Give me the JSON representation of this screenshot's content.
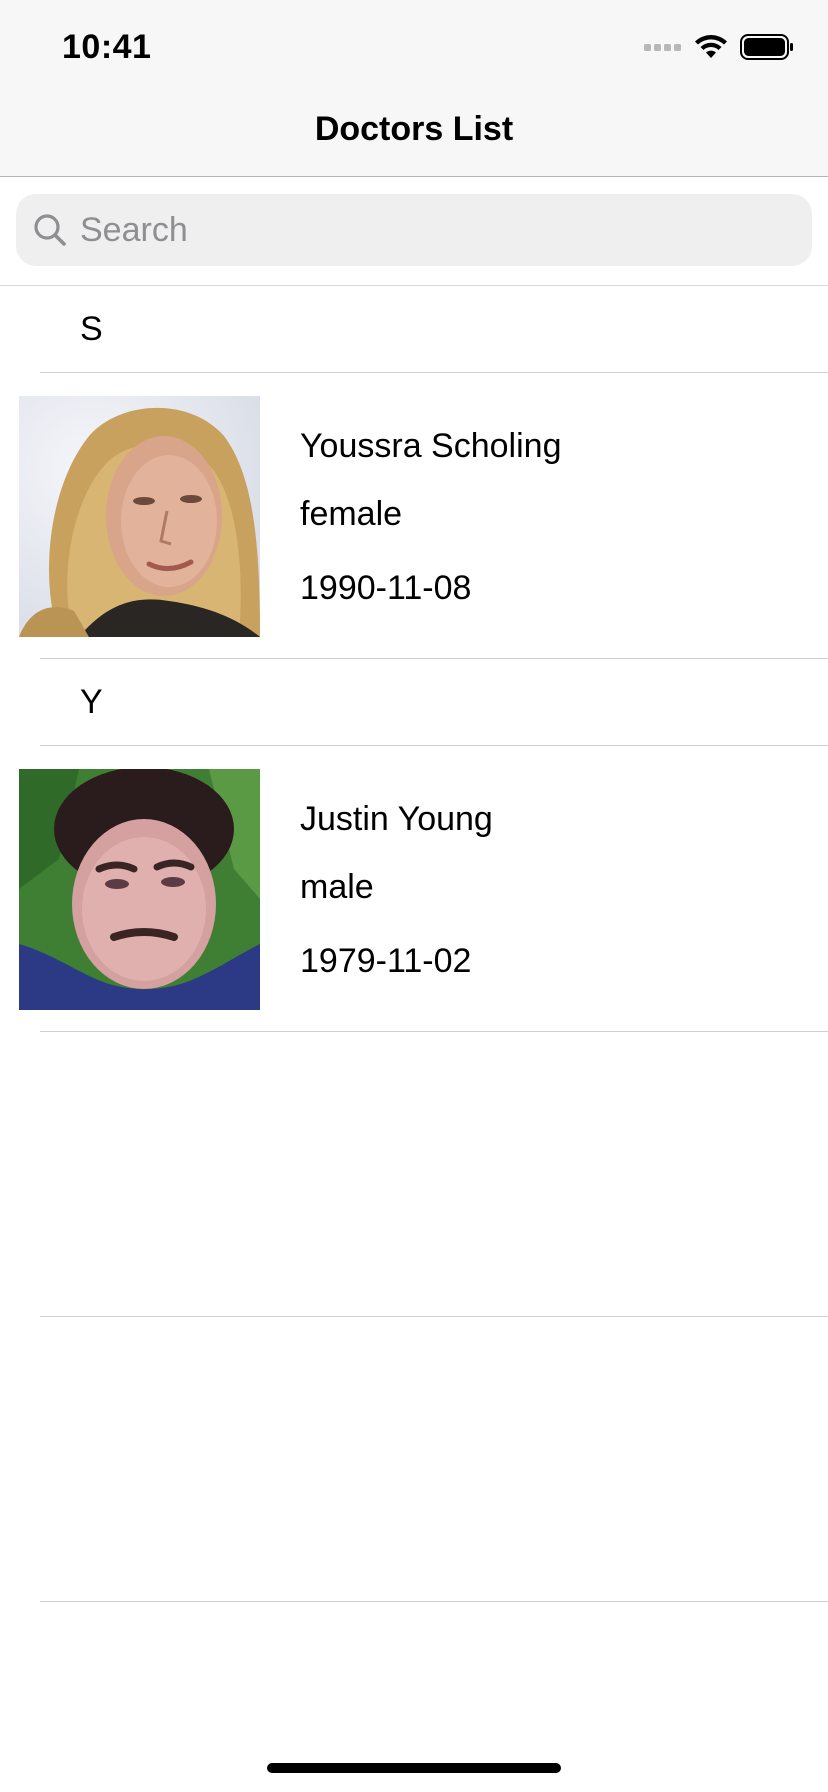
{
  "status_bar": {
    "time": "10:41",
    "icons": [
      "cellular-signal-icon",
      "wifi-icon",
      "battery-icon"
    ]
  },
  "nav": {
    "title": "Doctors List"
  },
  "search": {
    "placeholder": "Search",
    "value": ""
  },
  "sections": [
    {
      "letter": "S",
      "rows": [
        {
          "name": "Youssra Scholing",
          "gender": "female",
          "birthdate": "1990-11-08"
        }
      ]
    },
    {
      "letter": "Y",
      "rows": [
        {
          "name": "Justin Young",
          "gender": "male",
          "birthdate": "1979-11-02"
        }
      ]
    }
  ]
}
